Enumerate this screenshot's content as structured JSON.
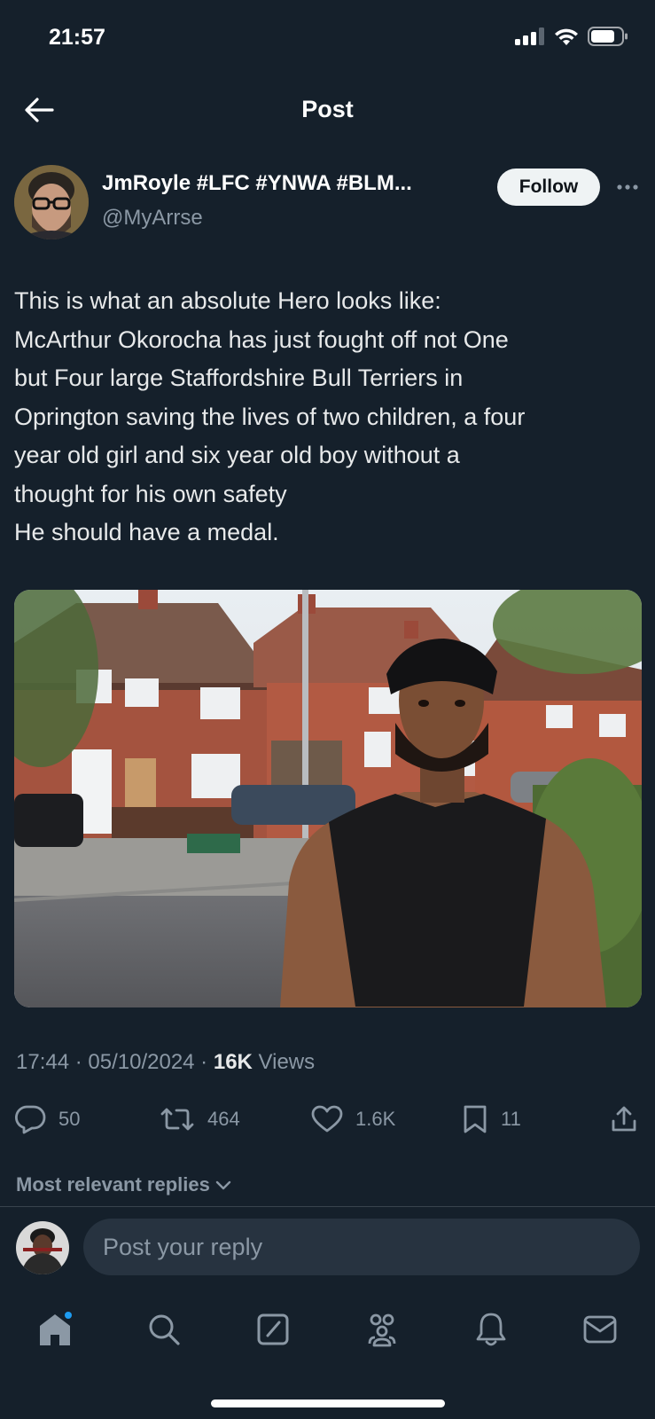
{
  "status_bar": {
    "time": "21:57"
  },
  "header": {
    "title": "Post"
  },
  "author": {
    "display_name": "JmRoyle #LFC #YNWA #BLM...",
    "handle": "@MyArrse",
    "follow_label": "Follow"
  },
  "tweet": {
    "lines": [
      "This is what an absolute Hero looks like:",
      "McArthur Okorocha has just fought off not One",
      "but Four large Staffordshire Bull Terriers in",
      "Oprington saving the lives of two children, a four",
      "year old girl and six year old boy without a",
      "thought for his own safety",
      "He should have a medal."
    ]
  },
  "meta": {
    "time": "17:44",
    "separator": " · ",
    "date": "05/10/2024",
    "views_count": "16K",
    "views_label": " Views"
  },
  "actions": {
    "replies": "50",
    "reposts": "464",
    "likes": "1.6K",
    "bookmarks": "11"
  },
  "replies_sort": {
    "label": "Most relevant replies"
  },
  "reply_bar": {
    "placeholder": "Post your reply"
  },
  "colors": {
    "background": "#15202b",
    "accent": "#1d9bf0",
    "muted": "#8b98a5"
  },
  "icons": [
    "back-arrow-icon",
    "more-icon",
    "reply-icon",
    "repost-icon",
    "like-icon",
    "bookmark-icon",
    "share-icon",
    "chevron-down-icon",
    "home-icon",
    "search-icon",
    "compose-icon",
    "communities-icon",
    "notifications-icon",
    "messages-icon"
  ]
}
